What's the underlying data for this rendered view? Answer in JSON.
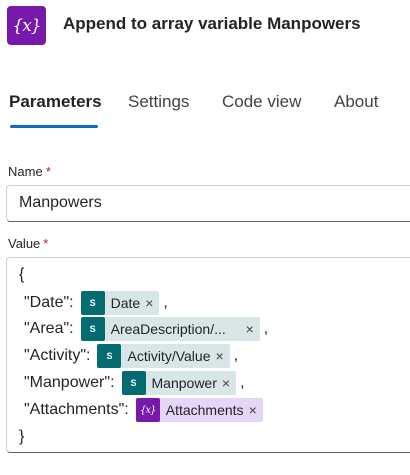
{
  "colors": {
    "action_icon": "#7719aa",
    "sharepoint_icon": "#036c70",
    "variable_icon": "#7719aa",
    "tab_accent": "#0f6cbd",
    "required": "#c50f1f"
  },
  "header": {
    "icon_text": "{x}",
    "icon_name": "variable-icon",
    "title": "Append to array variable Manpowers"
  },
  "tabs": [
    {
      "label": "Parameters",
      "active": true
    },
    {
      "label": "Settings",
      "active": false
    },
    {
      "label": "Code view",
      "active": false
    },
    {
      "label": "About",
      "active": false
    }
  ],
  "name_field": {
    "label": "Name",
    "required_mark": "*",
    "value": "Manpowers"
  },
  "value_field": {
    "label": "Value",
    "required_mark": "*",
    "open_brace": "{",
    "close_brace": "}",
    "lines": [
      {
        "key": "\"Date\":",
        "token_icon": "sharepoint-icon",
        "token_icon_text": "S",
        "token_label": "Date",
        "remove": "×",
        "trailing": ","
      },
      {
        "key": "\"Area\":",
        "token_icon": "sharepoint-icon",
        "token_icon_text": "S",
        "token_label": "AreaDescription/...",
        "remove": "×",
        "trailing": ","
      },
      {
        "key": "\"Activity\":",
        "token_icon": "sharepoint-icon",
        "token_icon_text": "S",
        "token_label": "Activity/Value",
        "remove": "×",
        "trailing": ","
      },
      {
        "key": "\"Manpower\":",
        "token_icon": "sharepoint-icon",
        "token_icon_text": "S",
        "token_label": "Manpower",
        "remove": "×",
        "trailing": ","
      },
      {
        "key": "\"Attachments\":",
        "token_icon": "variable-icon",
        "token_icon_text": "{x}",
        "token_label": "Attachments",
        "remove": "×",
        "trailing": ""
      }
    ]
  }
}
